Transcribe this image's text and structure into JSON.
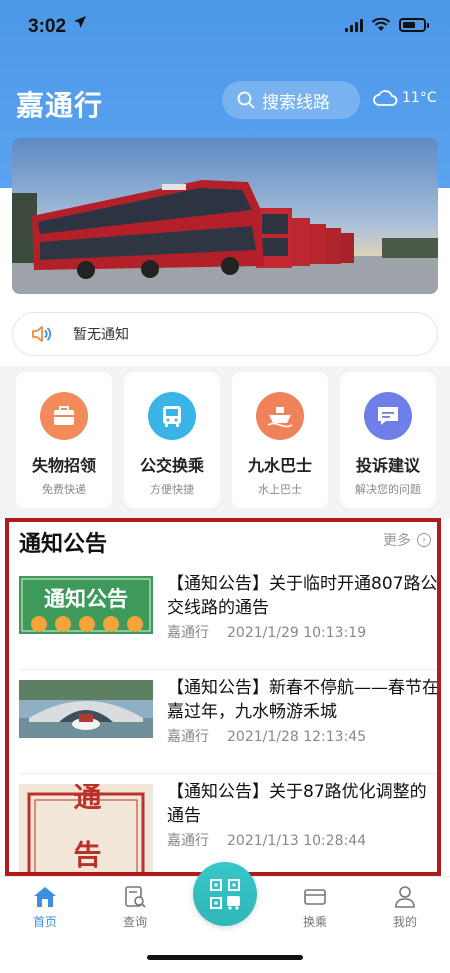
{
  "status_bar": {
    "time": "3:02"
  },
  "header": {
    "app_title": "嘉通行",
    "search_placeholder": "搜索线路",
    "temperature": "11°C"
  },
  "notice": {
    "text": "暂无通知"
  },
  "quick_cards": [
    {
      "title": "失物招领",
      "subtitle": "免费快递",
      "icon": "bag-icon",
      "color": "#f28b5b"
    },
    {
      "title": "公交换乘",
      "subtitle": "方便快捷",
      "icon": "bus-icon",
      "color": "#39b4e6"
    },
    {
      "title": "九水巴士",
      "subtitle": "水上巴士",
      "icon": "ship-icon",
      "color": "#f0825a"
    },
    {
      "title": "投诉建议",
      "subtitle": "解决您的问题",
      "icon": "chat-icon",
      "color": "#6f7ee8"
    }
  ],
  "announcements": {
    "heading": "通知公告",
    "more_label": "更多",
    "items": [
      {
        "title": "【通知公告】关于临时开通807路公交线路的通告",
        "source": "嘉通行",
        "datetime": "2021/1/29 10:13:19",
        "thumb_text": "通知公告"
      },
      {
        "title": "【通知公告】新春不停航——春节在嘉过年，九水畅游禾城",
        "source": "嘉通行",
        "datetime": "2021/1/28 12:13:45",
        "thumb_text": ""
      },
      {
        "title": "【通知公告】关于87路优化调整的通告",
        "source": "嘉通行",
        "datetime": "2021/1/13 10:28:44",
        "thumb_text": "通告"
      }
    ]
  },
  "tabbar": {
    "home": "首页",
    "query": "查询",
    "transfer": "换乘",
    "mine": "我的"
  },
  "colors": {
    "primary": "#4d97e8",
    "accent": "#3d8ee3",
    "fab": "#2fb6b8",
    "highlight_border": "#b01c1c"
  }
}
